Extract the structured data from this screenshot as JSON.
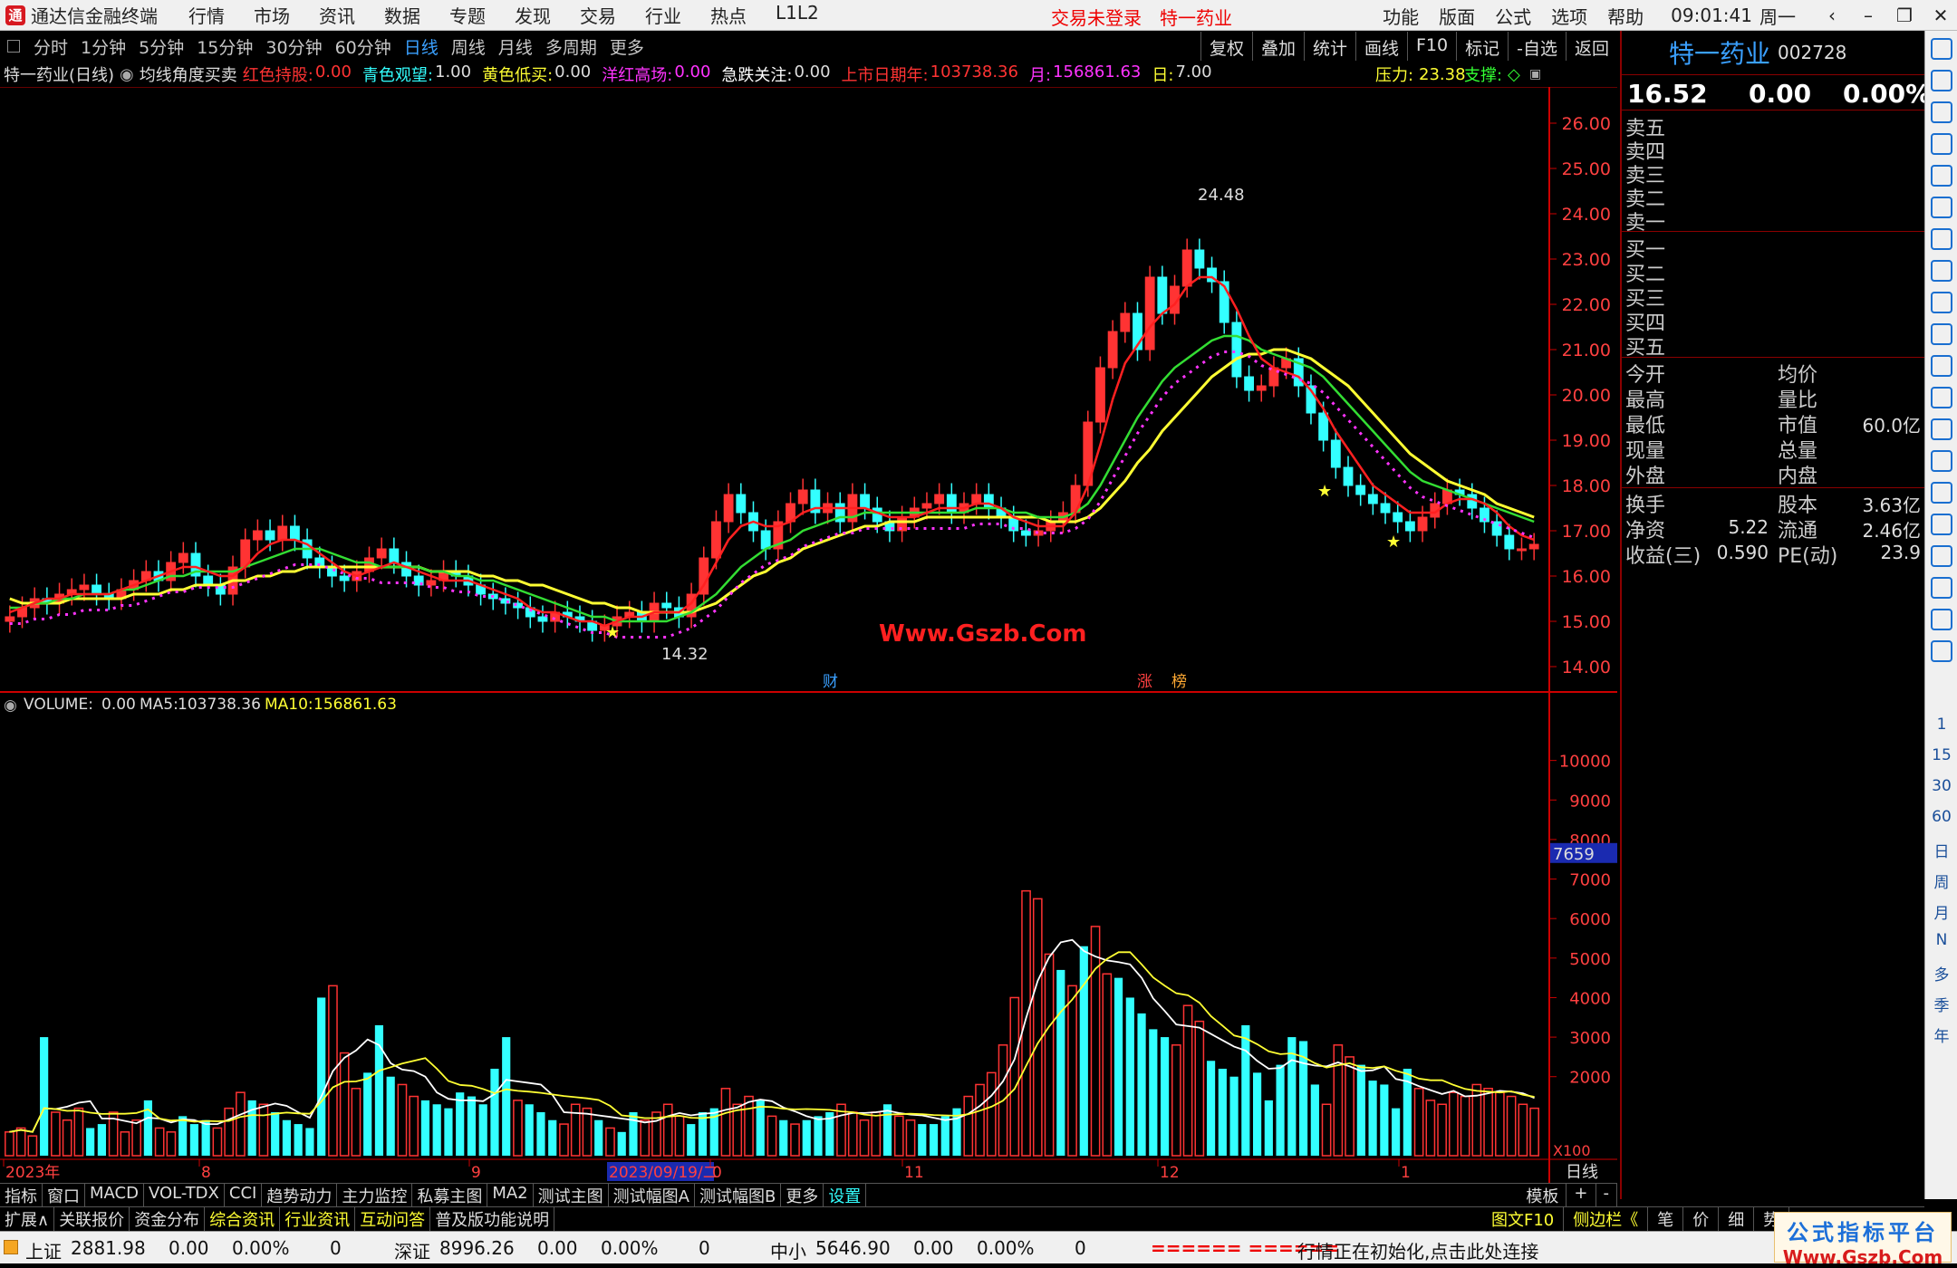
{
  "titlebar": {
    "app_title": "通达信金融终端",
    "menus": [
      "行情",
      "市场",
      "资讯",
      "数据",
      "专题",
      "发现",
      "交易",
      "行业",
      "热点",
      "L1L2"
    ],
    "status": "交易未登录",
    "stock": "特一药业",
    "right_menus": [
      "功能",
      "版面",
      "公式",
      "选项",
      "帮助"
    ],
    "time": "09:01:41",
    "weekday": "周一"
  },
  "periodbar": {
    "items": [
      "分时",
      "1分钟",
      "5分钟",
      "15分钟",
      "30分钟",
      "60分钟",
      "日线",
      "周线",
      "月线",
      "多周期",
      "更多"
    ],
    "active": "日线",
    "right_buttons": [
      "复权",
      "叠加",
      "统计",
      "画线",
      "F10",
      "标记",
      "-自选",
      "返回"
    ]
  },
  "indicator": {
    "name": "特一药业(日线)",
    "formula": "均线角度买卖",
    "items": [
      {
        "label": "红色持股:",
        "value": "0.00",
        "color": "#ff3333"
      },
      {
        "label": "青色观望:",
        "value": "1.00",
        "color": "#33ffff"
      },
      {
        "label": "黄色低买:",
        "value": "0.00",
        "color": "#ffff33"
      },
      {
        "label": "洋红高场:",
        "value": "0.00",
        "color": "#ff33ff"
      },
      {
        "label": "急跌关注:",
        "value": "0.00",
        "color": "#ffffff"
      },
      {
        "label": "上市日期年:",
        "value": "103738.36",
        "color": "#ff3333"
      },
      {
        "label": "月:",
        "value": "156861.63",
        "color": "#ff33ff"
      },
      {
        "label": "日:",
        "value": "7.00",
        "color": "#ffff33"
      }
    ],
    "pressure_label": "压力:",
    "pressure": "23.38",
    "support_label": "支撑:"
  },
  "volume_legend": {
    "vol_label": "VOLUME:",
    "vol": "0.00",
    "ma5_label": "MA5:",
    "ma5": "103738.36",
    "ma10_label": "MA10:",
    "ma10": "156861.63"
  },
  "chart_data": [
    {
      "type": "candlestick",
      "title": "特一药业(日线)",
      "y_ticks": [
        "26.00",
        "25.00",
        "24.00",
        "23.00",
        "22.00",
        "21.00",
        "20.00",
        "19.00",
        "18.00",
        "17.00",
        "16.00",
        "15.00",
        "14.00"
      ],
      "ylim": [
        13.6,
        26.4
      ],
      "x_labels": [
        "2023年",
        "8",
        "9",
        "2023/09/19/二",
        "0",
        "11",
        "12",
        "1"
      ],
      "annotations": {
        "high": "24.48",
        "low": "14.32",
        "watermark": "Www.Gszb.Com",
        "markers": [
          "财",
          "涨",
          "榜"
        ]
      },
      "close": [
        15.1,
        15.3,
        15.5,
        15.4,
        15.6,
        15.7,
        15.8,
        15.6,
        15.5,
        15.7,
        15.9,
        16.1,
        15.9,
        16.3,
        16.5,
        16.0,
        15.8,
        15.6,
        16.2,
        16.8,
        17.0,
        16.8,
        17.1,
        16.8,
        16.4,
        16.2,
        16.0,
        15.9,
        16.1,
        16.4,
        16.6,
        16.3,
        16.0,
        15.8,
        15.9,
        16.1,
        16.0,
        15.8,
        15.6,
        15.5,
        15.4,
        15.3,
        15.1,
        15.0,
        15.2,
        15.1,
        15.0,
        14.8,
        14.9,
        15.1,
        15.2,
        15.0,
        15.4,
        15.3,
        15.1,
        15.6,
        16.4,
        17.2,
        17.8,
        17.4,
        17.0,
        16.6,
        17.2,
        17.6,
        17.9,
        17.4,
        17.6,
        17.2,
        17.8,
        17.5,
        17.2,
        17.0,
        17.3,
        17.5,
        17.6,
        17.8,
        17.4,
        17.6,
        17.8,
        17.5,
        17.3,
        17.0,
        16.9,
        17.0,
        17.2,
        17.4,
        18.0,
        19.4,
        20.6,
        21.4,
        21.8,
        21.0,
        22.6,
        21.8,
        22.4,
        23.2,
        22.8,
        22.5,
        21.6,
        20.4,
        20.1,
        20.2,
        20.6,
        20.8,
        20.2,
        19.6,
        19.0,
        18.4,
        18.0,
        17.8,
        17.6,
        17.4,
        17.2,
        17.0,
        17.3,
        17.6,
        17.9,
        17.8,
        17.5,
        17.2,
        16.9,
        16.6,
        16.6,
        16.7
      ],
      "open": [
        15.0,
        15.1,
        15.3,
        15.5,
        15.4,
        15.6,
        15.7,
        15.8,
        15.6,
        15.5,
        15.7,
        15.9,
        16.1,
        15.9,
        16.3,
        16.5,
        16.0,
        15.8,
        15.6,
        16.2,
        16.8,
        17.0,
        16.8,
        17.1,
        16.8,
        16.4,
        16.2,
        16.0,
        15.9,
        16.1,
        16.4,
        16.6,
        16.3,
        16.0,
        15.8,
        15.9,
        16.1,
        16.0,
        15.8,
        15.6,
        15.5,
        15.4,
        15.3,
        15.1,
        15.0,
        15.2,
        15.1,
        15.0,
        14.8,
        14.9,
        15.1,
        15.2,
        15.0,
        15.4,
        15.3,
        15.1,
        15.6,
        16.4,
        17.2,
        17.8,
        17.4,
        17.0,
        16.6,
        17.2,
        17.6,
        17.9,
        17.4,
        17.6,
        17.2,
        17.8,
        17.5,
        17.2,
        17.0,
        17.3,
        17.5,
        17.6,
        17.8,
        17.4,
        17.6,
        17.8,
        17.5,
        17.3,
        17.0,
        16.9,
        17.0,
        17.2,
        17.4,
        18.0,
        19.4,
        20.6,
        21.4,
        21.8,
        21.0,
        22.6,
        21.8,
        22.4,
        23.2,
        22.8,
        22.5,
        21.6,
        20.4,
        20.1,
        20.2,
        20.6,
        20.8,
        20.2,
        19.6,
        19.0,
        18.4,
        18.0,
        17.8,
        17.6,
        17.4,
        17.2,
        17.0,
        17.3,
        17.6,
        17.9,
        17.8,
        17.5,
        17.2,
        16.9,
        16.6,
        16.6
      ],
      "ma_short": [
        15.2,
        15.3,
        15.4,
        15.5,
        15.5,
        15.6,
        15.6,
        15.6,
        15.6,
        15.7,
        15.8,
        15.9,
        16.0,
        16.1,
        16.2,
        16.2,
        16.1,
        16.0,
        16.0,
        16.2,
        16.5,
        16.7,
        16.8,
        16.8,
        16.7,
        16.5,
        16.3,
        16.1,
        16.0,
        16.1,
        16.2,
        16.3,
        16.2,
        16.1,
        16.0,
        15.9,
        15.9,
        15.9,
        15.8,
        15.7,
        15.6,
        15.5,
        15.3,
        15.2,
        15.2,
        15.1,
        15.0,
        15.0,
        14.9,
        15.0,
        15.1,
        15.1,
        15.2,
        15.2,
        15.2,
        15.4,
        15.8,
        16.3,
        16.8,
        17.1,
        17.2,
        17.1,
        17.1,
        17.2,
        17.4,
        17.5,
        17.5,
        17.5,
        17.5,
        17.5,
        17.4,
        17.3,
        17.3,
        17.3,
        17.4,
        17.5,
        17.5,
        17.5,
        17.6,
        17.6,
        17.5,
        17.3,
        17.2,
        17.1,
        17.1,
        17.1,
        17.4,
        18.0,
        18.9,
        19.9,
        20.7,
        21.1,
        21.5,
        21.8,
        22.0,
        22.4,
        22.6,
        22.6,
        22.4,
        21.9,
        21.3,
        20.8,
        20.6,
        20.5,
        20.4,
        20.1,
        19.7,
        19.2,
        18.8,
        18.4,
        18.0,
        17.8,
        17.6,
        17.4,
        17.4,
        17.4,
        17.6,
        17.7,
        17.7,
        17.6,
        17.4,
        17.1,
        16.9,
        16.8
      ],
      "ma_mid": [
        15.3,
        15.3,
        15.4,
        15.4,
        15.5,
        15.5,
        15.6,
        15.6,
        15.6,
        15.7,
        15.7,
        15.8,
        15.9,
        16.0,
        16.0,
        16.1,
        16.1,
        16.1,
        16.1,
        16.2,
        16.3,
        16.4,
        16.5,
        16.6,
        16.6,
        16.6,
        16.5,
        16.4,
        16.3,
        16.3,
        16.2,
        16.2,
        16.2,
        16.2,
        16.1,
        16.1,
        16.0,
        16.0,
        15.9,
        15.9,
        15.8,
        15.7,
        15.6,
        15.5,
        15.4,
        15.3,
        15.2,
        15.1,
        15.1,
        15.0,
        15.0,
        15.0,
        15.0,
        15.0,
        15.1,
        15.2,
        15.4,
        15.6,
        15.9,
        16.2,
        16.4,
        16.6,
        16.7,
        16.8,
        17.0,
        17.1,
        17.2,
        17.3,
        17.3,
        17.4,
        17.4,
        17.4,
        17.4,
        17.4,
        17.4,
        17.4,
        17.4,
        17.4,
        17.5,
        17.5,
        17.5,
        17.4,
        17.4,
        17.3,
        17.3,
        17.3,
        17.4,
        17.6,
        18.0,
        18.5,
        19.0,
        19.5,
        19.9,
        20.3,
        20.6,
        20.8,
        21.0,
        21.2,
        21.3,
        21.3,
        21.2,
        21.0,
        20.9,
        20.8,
        20.7,
        20.6,
        20.4,
        20.1,
        19.8,
        19.5,
        19.2,
        18.9,
        18.6,
        18.3,
        18.1,
        18.0,
        17.9,
        17.8,
        17.7,
        17.6,
        17.5,
        17.4,
        17.3,
        17.2
      ],
      "ma_long": [
        15.5,
        15.4,
        15.4,
        15.4,
        15.4,
        15.5,
        15.5,
        15.5,
        15.5,
        15.5,
        15.6,
        15.6,
        15.6,
        15.7,
        15.7,
        15.8,
        15.8,
        15.8,
        15.9,
        15.9,
        16.0,
        16.0,
        16.1,
        16.1,
        16.2,
        16.2,
        16.2,
        16.2,
        16.2,
        16.2,
        16.2,
        16.2,
        16.2,
        16.2,
        16.1,
        16.1,
        16.1,
        16.1,
        16.0,
        16.0,
        15.9,
        15.9,
        15.8,
        15.8,
        15.7,
        15.6,
        15.5,
        15.4,
        15.4,
        15.3,
        15.3,
        15.2,
        15.2,
        15.2,
        15.2,
        15.2,
        15.3,
        15.4,
        15.6,
        15.8,
        16.0,
        16.1,
        16.3,
        16.4,
        16.6,
        16.7,
        16.8,
        16.9,
        17.0,
        17.1,
        17.1,
        17.2,
        17.2,
        17.2,
        17.3,
        17.3,
        17.3,
        17.3,
        17.3,
        17.3,
        17.3,
        17.3,
        17.3,
        17.3,
        17.2,
        17.2,
        17.2,
        17.3,
        17.5,
        17.8,
        18.1,
        18.5,
        18.8,
        19.2,
        19.5,
        19.8,
        20.1,
        20.4,
        20.6,
        20.8,
        20.9,
        20.9,
        21.0,
        21.0,
        20.9,
        20.8,
        20.6,
        20.4,
        20.2,
        19.9,
        19.6,
        19.3,
        19.0,
        18.7,
        18.5,
        18.3,
        18.1,
        18.0,
        17.9,
        17.8,
        17.6,
        17.5,
        17.4,
        17.3
      ]
    },
    {
      "type": "bar",
      "title": "VOLUME",
      "y_ticks": [
        "10000",
        "9000",
        "8000",
        "7659",
        "7000",
        "6000",
        "5000",
        "4000",
        "3000",
        "2000"
      ],
      "y_unit": "X100",
      "ylim": [
        0,
        11000
      ],
      "x_labels": [
        "2023年",
        "8",
        "9",
        "2023/09/19/二",
        "0",
        "11",
        "12",
        "1"
      ],
      "period_label": "日线",
      "values": [
        600,
        700,
        500,
        3000,
        1100,
        900,
        1200,
        700,
        800,
        1100,
        600,
        900,
        1400,
        700,
        600,
        1000,
        800,
        900,
        700,
        1200,
        1600,
        1400,
        1300,
        1100,
        900,
        800,
        700,
        4000,
        4300,
        2600,
        1700,
        2100,
        3300,
        2000,
        1800,
        1500,
        1400,
        1300,
        1200,
        1600,
        1500,
        1300,
        2200,
        3000,
        1400,
        1300,
        1100,
        900,
        800,
        1300,
        1200,
        900,
        700,
        600,
        1100,
        900,
        1100,
        1300,
        1000,
        800,
        1100,
        1200,
        1700,
        1300,
        1500,
        1400,
        1000,
        900,
        800,
        900,
        1000,
        1100,
        1300,
        1100,
        900,
        1100,
        1300,
        1000,
        900,
        800,
        800,
        1000,
        1200,
        1500,
        1800,
        2100,
        2800,
        4000,
        6700,
        6500,
        5100,
        4700,
        4300,
        5300,
        5800,
        4600,
        4500,
        4000,
        3600,
        3200,
        3000,
        2800,
        3800,
        3400,
        2400,
        2200,
        2000,
        3300,
        2100,
        1400,
        2300,
        3000,
        2900,
        1800,
        1300,
        2800,
        2500,
        2300,
        1900,
        1800,
        1200,
        2200,
        1700,
        1400,
        1300,
        1600,
        1500,
        1800,
        1700,
        1600,
        1500,
        1300,
        1200
      ]
    }
  ],
  "quote": {
    "name": "特一药业",
    "code": "002728",
    "price": "16.52",
    "change": "0.00",
    "pct": "0.00%",
    "sell": [
      "卖五",
      "卖四",
      "卖三",
      "卖二",
      "卖一"
    ],
    "buy": [
      "买一",
      "买二",
      "买三",
      "买四",
      "买五"
    ],
    "stats_left": [
      "今开",
      "最高",
      "最低",
      "现量",
      "外盘"
    ],
    "stats_right": [
      "均价",
      "量比",
      "市值",
      "总量",
      "内盘"
    ],
    "market_value": "60.0亿",
    "fund_labels_left": [
      "换手",
      "净资",
      "收益(三)"
    ],
    "fund_values_left": [
      "",
      "5.22",
      "0.590"
    ],
    "fund_labels_right": [
      "股本",
      "流通",
      "PE(动)"
    ],
    "fund_values_right": [
      "3.63亿",
      "2.46亿",
      "23.9"
    ]
  },
  "sidebar": {
    "labels": [
      "1",
      "15",
      "30",
      "60",
      "日",
      "周",
      "月",
      "N",
      "多",
      "季",
      "年"
    ]
  },
  "tabs1": {
    "items": [
      "指标",
      "窗口",
      "MACD",
      "VOL-TDX",
      "CCI",
      "趋势动力",
      "主力监控",
      "私募主图",
      "MA2",
      "测试主图",
      "测试幅图A",
      "测试幅图B",
      "更多",
      "设置"
    ],
    "right": [
      "模板",
      "+",
      "-"
    ]
  },
  "tabs2": {
    "items": [
      "扩展∧",
      "关联报价",
      "资金分布",
      "综合资讯",
      "行业资讯",
      "互动问答",
      "普及版功能说明"
    ],
    "right": [
      "图文F10",
      "侧边栏《",
      "笔",
      "价",
      "细",
      "势"
    ]
  },
  "statusbar": {
    "indices": [
      {
        "name": "上证",
        "value": "2881.98",
        "chg": "0.00",
        "pct": "0.00%",
        "vol": "0"
      },
      {
        "name": "深证",
        "value": "8996.26",
        "chg": "0.00",
        "pct": "0.00%",
        "vol": "0"
      },
      {
        "name": "中小",
        "value": "5646.90",
        "chg": "0.00",
        "pct": "0.00%",
        "vol": "0"
      }
    ],
    "bars": "====== ======",
    "message": "行情正在初始化,点击此处连接",
    "logo_cn": "公式指标平台",
    "logo_url": "Www.Gszb.Com"
  },
  "colors": {
    "up": "#ff3333",
    "down": "#33ffff",
    "ma_short": "#ff2020",
    "ma_mid": "#33dd33",
    "ma_long": "#ffff33",
    "ma_dotted": "#ff33ff",
    "axis": "#cc0000"
  }
}
